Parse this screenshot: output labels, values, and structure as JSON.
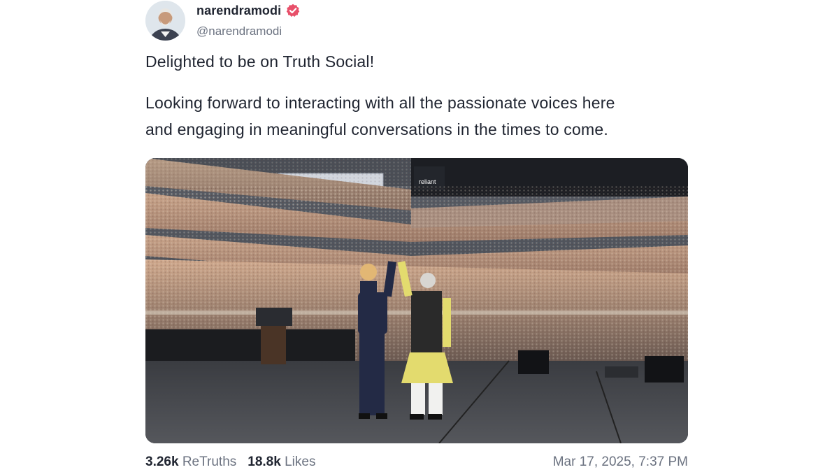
{
  "author": {
    "display_name": "narendramodi",
    "handle": "@narendramodi",
    "verified": true,
    "verified_color": "#e8506a"
  },
  "post": {
    "text_p1": "Delighted to be on Truth Social!",
    "text_p2_line1": "Looking forward to interacting with all the passionate voices here",
    "text_p2_line2": "and engaging in meaningful conversations in the times to come.",
    "media": {
      "sign_text": "reliant"
    }
  },
  "stats": {
    "retruths_count": "3.26k",
    "retruths_label": "ReTruths",
    "likes_count": "18.8k",
    "likes_label": "Likes"
  },
  "timestamp": "Mar 17, 2025, 7:37 PM",
  "colors": {
    "text_primary": "#1f2430",
    "text_secondary": "#6b7280"
  }
}
